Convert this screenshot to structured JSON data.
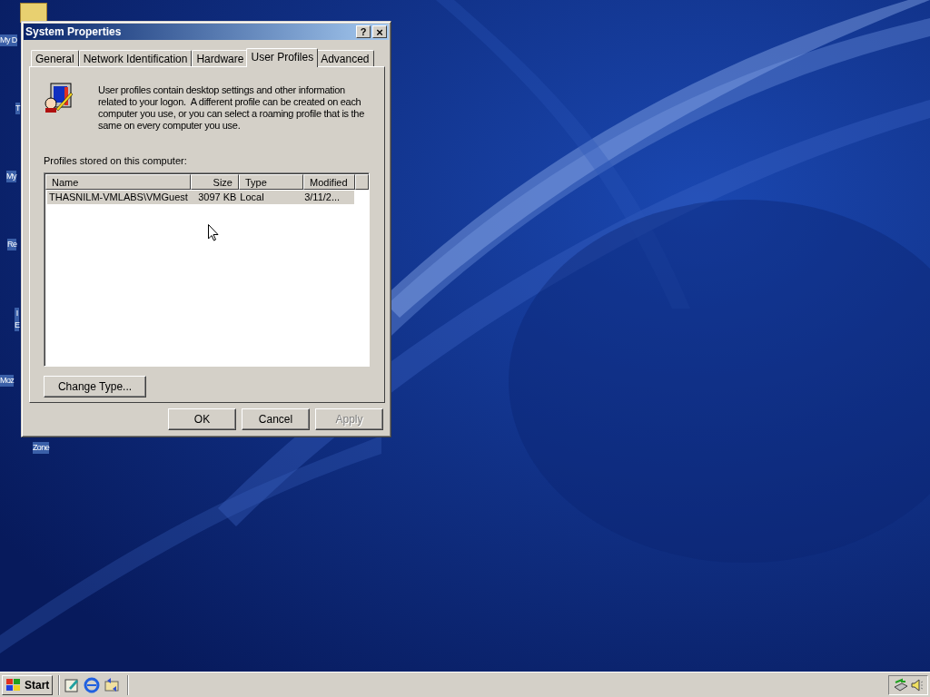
{
  "desktop_icons": [
    {
      "label": "My D"
    },
    {
      "label": "T"
    },
    {
      "label": "My"
    },
    {
      "label": "Re"
    },
    {
      "label": "I\nE"
    },
    {
      "label": "Moz"
    },
    {
      "label": "Zone"
    }
  ],
  "window": {
    "title": "System Properties",
    "help": "?",
    "close": "×"
  },
  "tabs": [
    {
      "label": "General",
      "selected": false
    },
    {
      "label": "Network Identification",
      "selected": false
    },
    {
      "label": "Hardware",
      "selected": false
    },
    {
      "label": "User Profiles",
      "selected": true
    },
    {
      "label": "Advanced",
      "selected": false
    }
  ],
  "intro": "User profiles contain desktop settings and other information related to your logon.  A different profile can be created on each computer you use, or you can select a roaming profile that is the same on every computer you use.",
  "list_label": "Profiles stored on this computer:",
  "table": {
    "columns": [
      "Name",
      "Size",
      "Type",
      "Modified"
    ],
    "rows": [
      {
        "cells": [
          "THASNILM-VMLABS\\VMGuest",
          "3097 KB",
          "Local",
          "3/11/2..."
        ],
        "selected": true
      }
    ]
  },
  "change_type_button": {
    "label": "Change Type...",
    "disabled": false
  },
  "buttons": [
    {
      "label": "OK",
      "disabled": false
    },
    {
      "label": "Cancel",
      "disabled": false
    },
    {
      "label": "Apply",
      "disabled": true
    }
  ],
  "taskbar": {
    "start": "Start"
  }
}
